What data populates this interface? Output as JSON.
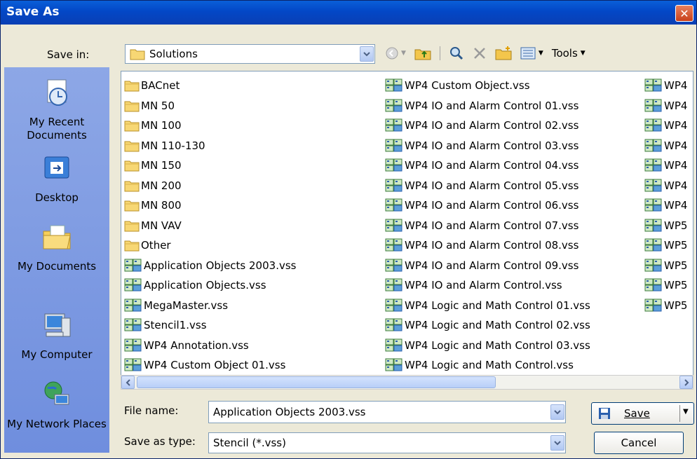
{
  "window": {
    "title": "Save As",
    "close_glyph": "✕"
  },
  "save_in": {
    "label": "Save in:",
    "value": "Solutions"
  },
  "toolbar": {
    "tools_label": "Tools"
  },
  "places": [
    {
      "label": "My Recent Documents",
      "icon": "recent-documents-icon"
    },
    {
      "label": "Desktop",
      "icon": "desktop-icon"
    },
    {
      "label": "My Documents",
      "icon": "my-documents-icon"
    },
    {
      "label": "My Computer",
      "icon": "my-computer-icon"
    },
    {
      "label": "My Network Places",
      "icon": "network-places-icon"
    }
  ],
  "files": {
    "column1": [
      {
        "name": "BACnet",
        "type": "folder"
      },
      {
        "name": "MN 50",
        "type": "folder"
      },
      {
        "name": "MN 100",
        "type": "folder"
      },
      {
        "name": "MN 110-130",
        "type": "folder"
      },
      {
        "name": "MN 150",
        "type": "folder"
      },
      {
        "name": "MN 200",
        "type": "folder"
      },
      {
        "name": "MN 800",
        "type": "folder"
      },
      {
        "name": "MN VAV",
        "type": "folder"
      },
      {
        "name": "Other",
        "type": "folder"
      },
      {
        "name": "Application Objects 2003.vss",
        "type": "vss"
      },
      {
        "name": "Application Objects.vss",
        "type": "vss"
      },
      {
        "name": "MegaMaster.vss",
        "type": "vss"
      },
      {
        "name": "Stencil1.vss",
        "type": "vss"
      },
      {
        "name": "WP4 Annotation.vss",
        "type": "vss"
      },
      {
        "name": "WP4 Custom Object 01.vss",
        "type": "vss"
      }
    ],
    "column2": [
      {
        "name": "WP4 Custom Object.vss",
        "type": "vss"
      },
      {
        "name": "WP4 IO and Alarm Control 01.vss",
        "type": "vss"
      },
      {
        "name": "WP4 IO and Alarm Control 02.vss",
        "type": "vss"
      },
      {
        "name": "WP4 IO and Alarm Control 03.vss",
        "type": "vss"
      },
      {
        "name": "WP4 IO and Alarm Control 04.vss",
        "type": "vss"
      },
      {
        "name": "WP4 IO and Alarm Control 05.vss",
        "type": "vss"
      },
      {
        "name": "WP4 IO and Alarm Control 06.vss",
        "type": "vss"
      },
      {
        "name": "WP4 IO and Alarm Control 07.vss",
        "type": "vss"
      },
      {
        "name": "WP4 IO and Alarm Control 08.vss",
        "type": "vss"
      },
      {
        "name": "WP4 IO and Alarm Control 09.vss",
        "type": "vss"
      },
      {
        "name": "WP4 IO and Alarm Control.vss",
        "type": "vss"
      },
      {
        "name": "WP4 Logic and Math Control 01.vss",
        "type": "vss"
      },
      {
        "name": "WP4 Logic and Math Control 02.vss",
        "type": "vss"
      },
      {
        "name": "WP4 Logic and Math Control 03.vss",
        "type": "vss"
      },
      {
        "name": "WP4 Logic and Math Control.vss",
        "type": "vss"
      }
    ],
    "column3": [
      {
        "name": "WP4",
        "type": "vss"
      },
      {
        "name": "WP4",
        "type": "vss"
      },
      {
        "name": "WP4",
        "type": "vss"
      },
      {
        "name": "WP4",
        "type": "vss"
      },
      {
        "name": "WP4",
        "type": "vss"
      },
      {
        "name": "WP4",
        "type": "vss"
      },
      {
        "name": "WP4",
        "type": "vss"
      },
      {
        "name": "WP5",
        "type": "vss"
      },
      {
        "name": "WP5",
        "type": "vss"
      },
      {
        "name": "WP5",
        "type": "vss"
      },
      {
        "name": "WP5",
        "type": "vss"
      },
      {
        "name": "WP5",
        "type": "vss"
      }
    ]
  },
  "file_name": {
    "label": "File name:",
    "value": "Application Objects 2003.vss"
  },
  "save_as_type": {
    "label": "Save as type:",
    "value": "Stencil (*.vss)"
  },
  "buttons": {
    "save": "Save",
    "cancel": "Cancel"
  }
}
